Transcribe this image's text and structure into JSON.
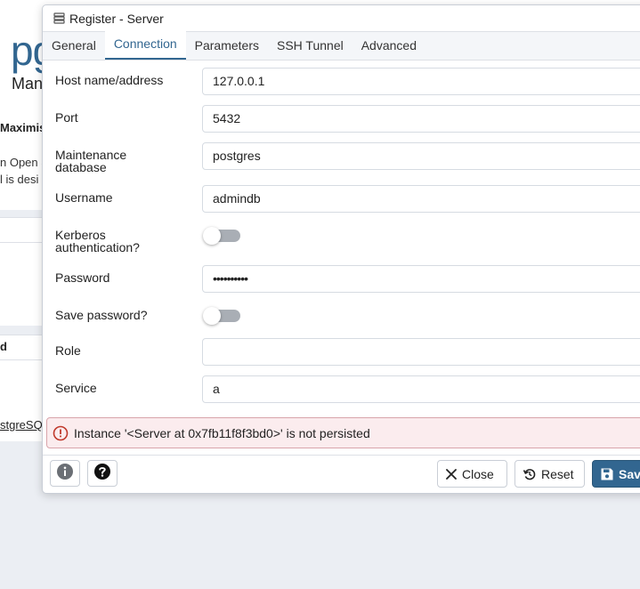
{
  "background": {
    "logo_text": "pg",
    "subtitle": "Man",
    "heading": "Maximis",
    "line1": "n Open S",
    "line2": "l is desi",
    "column_header": "d",
    "link": "stgreSQ"
  },
  "dialog": {
    "title": "Register - Server",
    "tabs": [
      {
        "label": "General"
      },
      {
        "label": "Connection"
      },
      {
        "label": "Parameters"
      },
      {
        "label": "SSH Tunnel"
      },
      {
        "label": "Advanced"
      }
    ],
    "active_tab": "Connection",
    "fields": {
      "host": {
        "label": "Host name/address",
        "value": "127.0.0.1"
      },
      "port": {
        "label": "Port",
        "value": "5432"
      },
      "maintenance_db": {
        "label_line1": "Maintenance",
        "label_line2": "database",
        "value": "postgres"
      },
      "username": {
        "label": "Username",
        "value": "admindb"
      },
      "kerberos": {
        "label_line1": "Kerberos",
        "label_line2": "authentication?",
        "enabled": false
      },
      "password": {
        "label": "Password",
        "value": "••••••••••"
      },
      "save_password": {
        "label": "Save password?",
        "enabled": false
      },
      "role": {
        "label": "Role",
        "value": ""
      },
      "service": {
        "label": "Service",
        "value": "a"
      }
    },
    "error_message": "Instance '<Server at 0x7fb11f8f3bd0>' is not persisted",
    "buttons": {
      "close": "Close",
      "reset": "Reset",
      "save": "Save"
    }
  },
  "colors": {
    "accent": "#326690",
    "error_bg": "#fbecee",
    "error_icon": "#c0392b"
  }
}
